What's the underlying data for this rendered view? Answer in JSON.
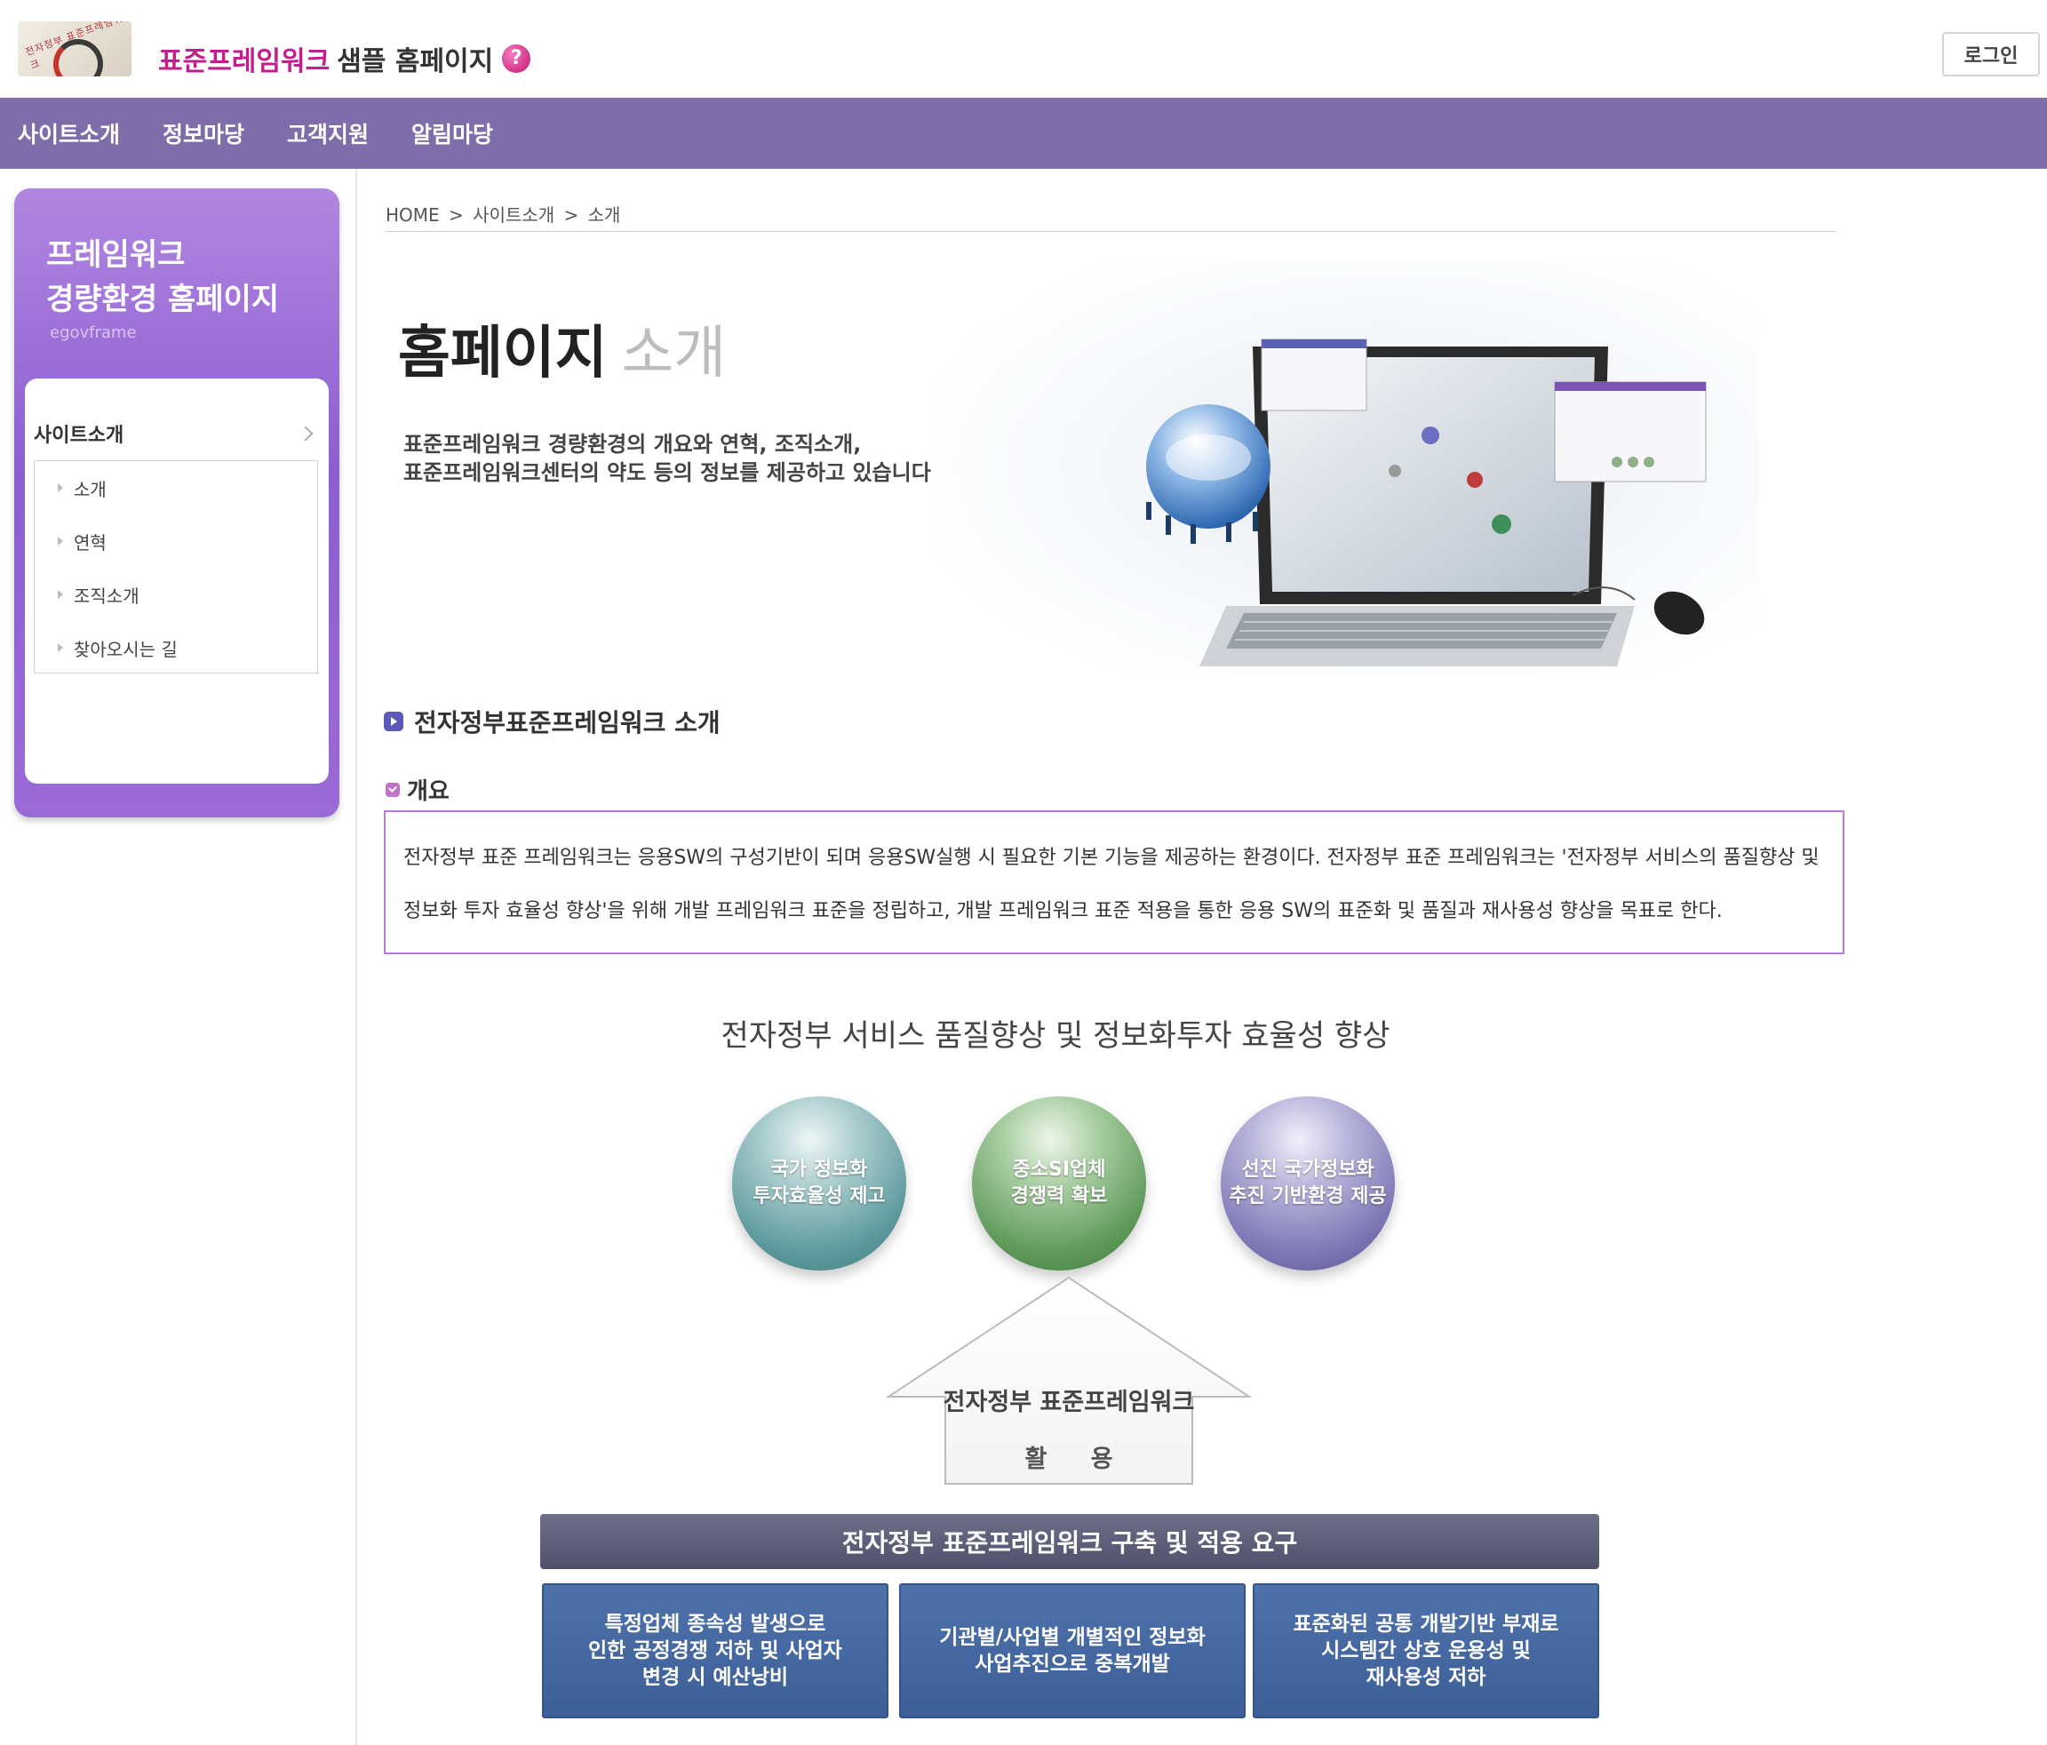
{
  "header": {
    "logo_text": "전자정부 표준프레임워크",
    "title_accent": "표준프레임워크",
    "title_rest": "샘플 홈페이지",
    "help_glyph": "?",
    "login_label": "로그인"
  },
  "nav": {
    "items": [
      "사이트소개",
      "정보마당",
      "고객지원",
      "알림마당"
    ]
  },
  "sidebar": {
    "title_line1": "프레임워크",
    "title_line2": "경량환경 홈페이지",
    "subtitle": "egovframe",
    "section_label": "사이트소개",
    "items": [
      "소개",
      "연혁",
      "조직소개",
      "찾아오시는 길"
    ]
  },
  "breadcrumb": [
    "HOME",
    ">",
    "사이트소개",
    ">",
    "소개"
  ],
  "hero": {
    "title_strong": "홈페이지",
    "title_light": "소개",
    "desc_line1": "표준프레임워크 경량환경의 개요와 연혁, 조직소개,",
    "desc_line2": "표준프레임워크센터의 약도 등의 정보를 제공하고 있습니다."
  },
  "section": {
    "title": "전자정부표준프레임워크 소개",
    "subtitle": "개요",
    "overview": "전자정부 표준 프레임워크는 응용SW의 구성기반이 되며 응용SW실행 시 필요한 기본 기능을 제공하는 환경이다. 전자정부 표준 프레임워크는 '전자정부 서비스의 품질향상 및 정보화 투자 효율성 향상'을 위해 개발 프레임워크 표준을 정립하고, 개발 프레임워크 표준 적용을 통한 응용 SW의 표준화 및 품질과 재사용성 향상을 목표로 한다."
  },
  "diagram": {
    "title": "전자정부 서비스 품질향상 및 정보화투자 효율성 향상",
    "spheres": [
      {
        "line1": "국가 정보화",
        "line2": "투자효율성 제고"
      },
      {
        "line1": "중소SI업체",
        "line2": "경쟁력 확보"
      },
      {
        "line1": "선진 국가정보화",
        "line2": "추진 기반환경 제공"
      }
    ],
    "arrow_line1": "전자정부 표준프레임워크",
    "arrow_line2": "활 용",
    "bar": "전자정부 표준프레임워크 구축 및 적용 요구",
    "boxes": [
      {
        "line1": "특정업체 종속성 발생으로",
        "line2": "인한 공정경쟁 저하 및 사업자",
        "line3": "변경 시 예산낭비"
      },
      {
        "line1": "기관별/사업별 개별적인 정보화",
        "line2": "사업추진으로 중복개발",
        "line3": ""
      },
      {
        "line1": "표준화된 공통 개발기반 부재로",
        "line2": "시스템간 상호 운용성 및",
        "line3": "재사용성 저하"
      }
    ]
  },
  "colors": {
    "nav_bg": "#7f6daa",
    "accent": "#c0208c",
    "sidebar": "#9a6bd6",
    "overview_border": "#b77fd4",
    "box_blue": "#3d5f98"
  }
}
